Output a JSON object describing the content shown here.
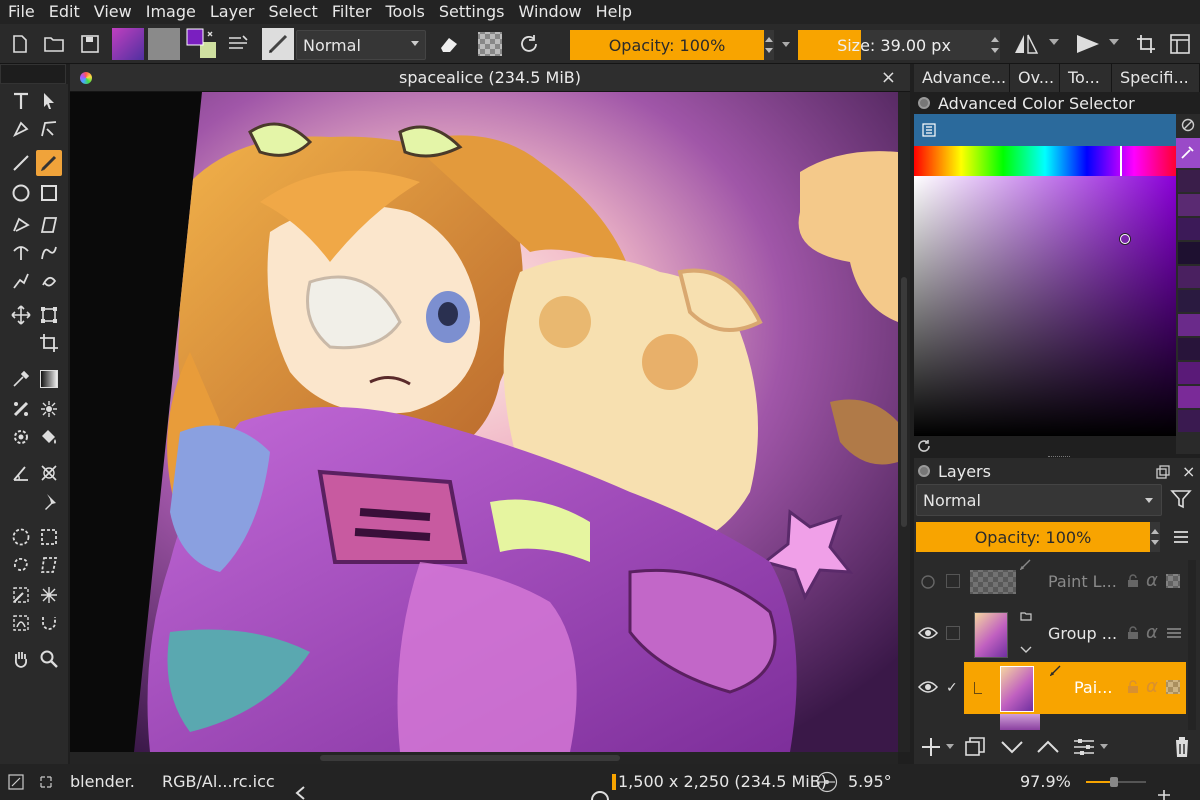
{
  "menu": [
    "File",
    "Edit",
    "View",
    "Image",
    "Layer",
    "Select",
    "Filter",
    "Tools",
    "Settings",
    "Window",
    "Help"
  ],
  "toolbar": {
    "blend_mode": "Normal",
    "opacity_label": "Opacity: 100%",
    "opacity_value": 1.0,
    "size_label": "Size: 39.00 px",
    "size_fill": 0.33,
    "foreground_color": "#7a1fc0",
    "background_color": "#cfe0a0",
    "accent_color": "#f8a400"
  },
  "document": {
    "title": "spacealice (234.5 MiB)",
    "close_glyph": "×"
  },
  "dockers": {
    "tabs": [
      "Advance...",
      "Ov...",
      "To...",
      "Specifi..."
    ],
    "color_selector_title": "Advanced Color Selector",
    "selected_hue": "#8a00d8"
  },
  "layers": {
    "title": "Layers",
    "blend_mode": "Normal",
    "opacity_label": "Opacity:  100%",
    "rows": [
      {
        "name": "Paint L...",
        "visible": false,
        "selected": false
      },
      {
        "name": "Group ...",
        "visible": true,
        "selected": false
      },
      {
        "name": "Pai...",
        "visible": true,
        "selected": true
      }
    ]
  },
  "status": {
    "brush": "blender.",
    "color_profile": "RGB/Al...rc.icc",
    "dimensions": "1,500 x 2,250 (234.5 MiB)",
    "rotation": "5.95°",
    "zoom": "97.9%"
  }
}
